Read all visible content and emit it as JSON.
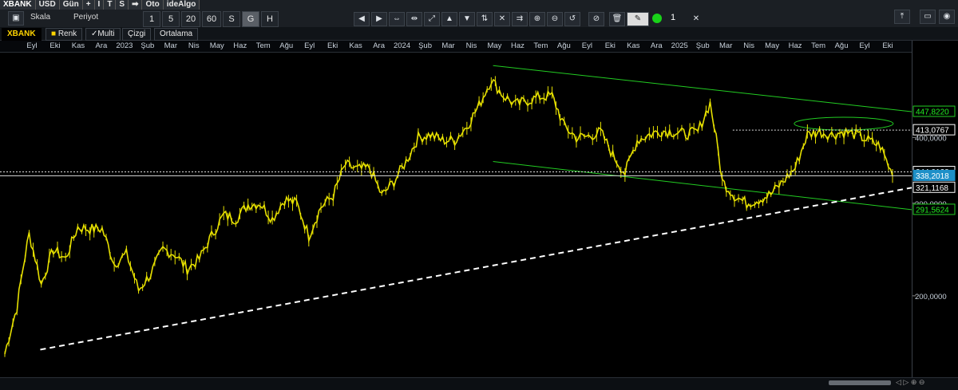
{
  "toolbar": {
    "row1": [
      "XBANK",
      "USD",
      "Gün",
      "+",
      "I",
      "T",
      "S",
      "Oto",
      "ideAlgo"
    ],
    "scale_label": "Skala",
    "period_label": "Periyot",
    "periods": [
      "1",
      "5",
      "20",
      "60",
      "S",
      "G",
      "H"
    ],
    "selected_period": "G",
    "count": "1"
  },
  "tabs": [
    "XBANK",
    "Renk",
    "Multi",
    "Çizgi",
    "Ortalama"
  ],
  "colors": {
    "price": "#e6e000",
    "channel": "#22cc22",
    "trend": "#ffffff",
    "current": "#1e90c8"
  },
  "chart_data": {
    "type": "line",
    "x_labels": [
      "Eyl",
      "Eki",
      "Kas",
      "Ara",
      "2023",
      "Şub",
      "Mar",
      "Nis",
      "May",
      "Haz",
      "Tem",
      "Ağu",
      "Eyl",
      "Eki",
      "Kas",
      "Ara",
      "2024",
      "Şub",
      "Mar",
      "Nis",
      "May",
      "Haz",
      "Tem",
      "Ağu",
      "Eyl",
      "Eki",
      "Kas",
      "Ara",
      "2025",
      "Şub",
      "Mar",
      "Nis",
      "May",
      "Haz",
      "Tem",
      "Ağu",
      "Eyl",
      "Eki"
    ],
    "y_scale": "log",
    "y_ticks": [
      "400,0000",
      "300,0000",
      "200,0000"
    ],
    "ylim": [
      145,
      560
    ],
    "series": [
      {
        "values": [
          155,
          190,
          262,
          210,
          245,
          235,
          270,
          268,
          268,
          230,
          240,
          205,
          220,
          245,
          240,
          225,
          235,
          260,
          285,
          280,
          298,
          300,
          280,
          305,
          300,
          260,
          295,
          310,
          355,
          348,
          350,
          310,
          330,
          360,
          400,
          405,
          395,
          395,
          420,
          460,
          515,
          480,
          462,
          470,
          478,
          480,
          420,
          400,
          402,
          410,
          370,
          342,
          395,
          405,
          412,
          410,
          406,
          410,
          465,
          330,
          310,
          300,
          305,
          312,
          330,
          350,
          405,
          410,
          405,
          410,
          405,
          395,
          385,
          338
        ]
      }
    ],
    "price_labels": [
      "447,8220",
      "413,0767",
      "344,0128",
      "338,2018",
      "321,1168",
      "291,5624"
    ],
    "annotations": [
      "upper channel",
      "lower channel",
      "support trendline",
      "resistance 413,0767",
      "support 344,0128"
    ]
  }
}
